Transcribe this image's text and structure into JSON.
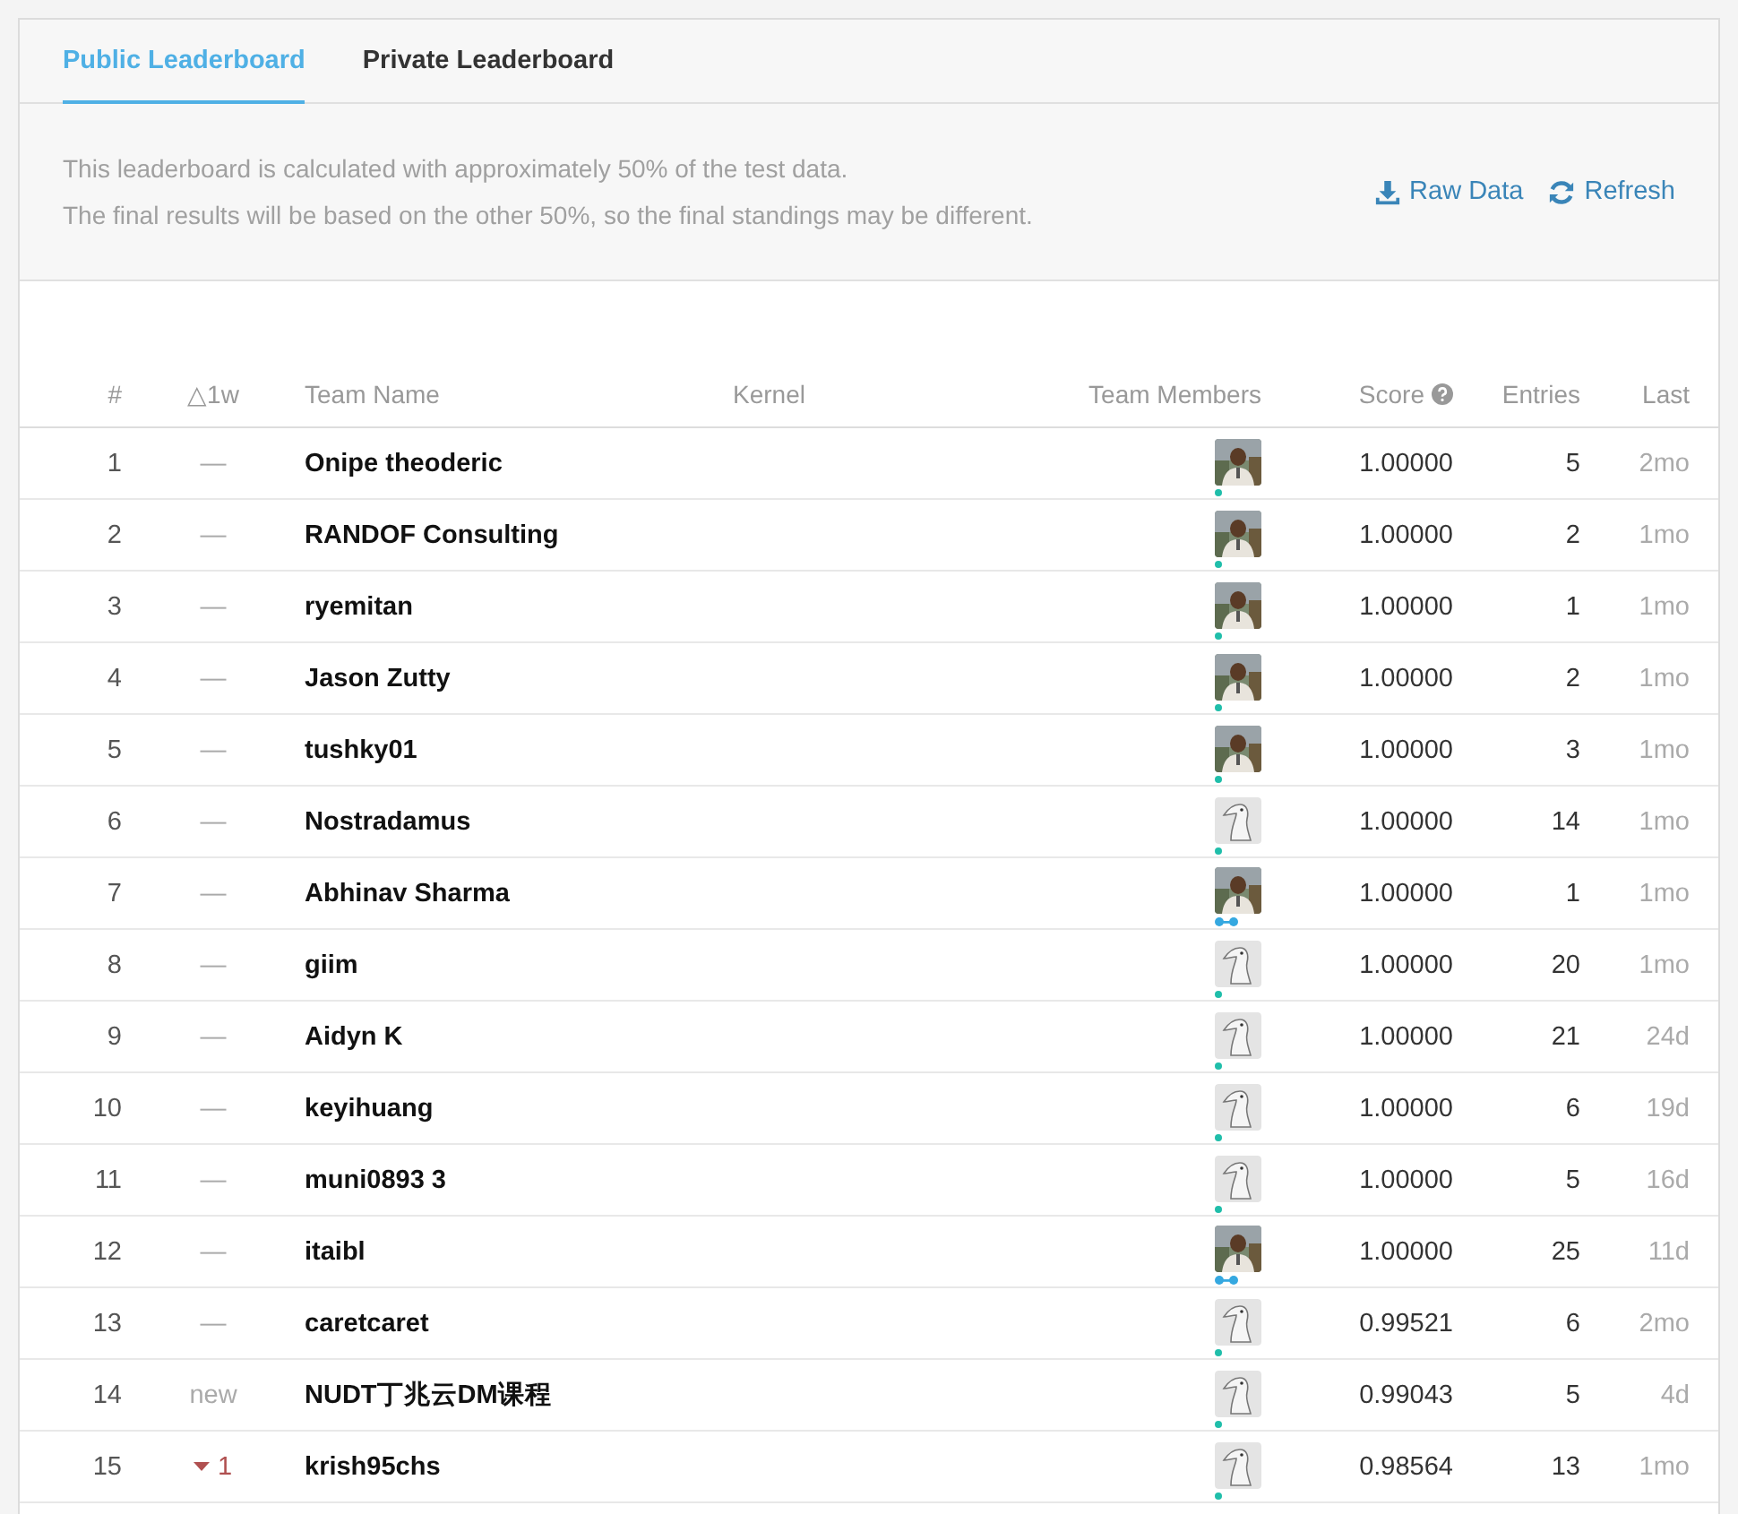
{
  "tabs": [
    {
      "label": "Public Leaderboard",
      "selected": true
    },
    {
      "label": "Private Leaderboard",
      "selected": false
    }
  ],
  "info": {
    "lines": [
      "This leaderboard is calculated with approximately 50% of the test data.",
      "The final results will be based on the other 50%, so the final standings may be different."
    ],
    "actions": [
      {
        "kind": "download",
        "label": "Raw Data"
      },
      {
        "kind": "refresh",
        "label": "Refresh"
      }
    ]
  },
  "table": {
    "columns": [
      "#",
      "△1w",
      "Team Name",
      "Kernel",
      "Team Members",
      "Score",
      "Entries",
      "Last"
    ],
    "rows": [
      {
        "rank": "1",
        "change": {
          "kind": "same",
          "text": "—"
        },
        "team": "Onipe theoderic",
        "member": {
          "badge": {
            "kind": "dot"
          }
        },
        "score": "1.00000",
        "entries": "5",
        "last": "2mo"
      },
      {
        "rank": "2",
        "change": {
          "kind": "same",
          "text": "—"
        },
        "team": "RANDOF Consulting",
        "member": {
          "badge": {
            "kind": "dot"
          }
        },
        "score": "1.00000",
        "entries": "2",
        "last": "1mo"
      },
      {
        "rank": "3",
        "change": {
          "kind": "same",
          "text": "—"
        },
        "team": "ryemitan",
        "member": {
          "badge": {
            "kind": "dot"
          }
        },
        "score": "1.00000",
        "entries": "1",
        "last": "1mo"
      },
      {
        "rank": "4",
        "change": {
          "kind": "same",
          "text": "—"
        },
        "team": "Jason Zutty",
        "member": {
          "badge": {
            "kind": "dot"
          }
        },
        "score": "1.00000",
        "entries": "2",
        "last": "1mo"
      },
      {
        "rank": "5",
        "change": {
          "kind": "same",
          "text": "—"
        },
        "team": "tushky01",
        "member": {
          "badge": {
            "kind": "dot"
          }
        },
        "score": "1.00000",
        "entries": "3",
        "last": "1mo"
      },
      {
        "rank": "6",
        "change": {
          "kind": "same",
          "text": "—"
        },
        "team": "Nostradamus",
        "member": {
          "kind": "default",
          "badge": {
            "kind": "dot"
          }
        },
        "score": "1.00000",
        "entries": "14",
        "last": "1mo"
      },
      {
        "rank": "7",
        "change": {
          "kind": "same",
          "text": "—"
        },
        "team": "Abhinav Sharma",
        "member": {
          "badge": {
            "kind": "bar"
          }
        },
        "score": "1.00000",
        "entries": "1",
        "last": "1mo"
      },
      {
        "rank": "8",
        "change": {
          "kind": "same",
          "text": "—"
        },
        "team": "giim",
        "member": {
          "kind": "default",
          "badge": {
            "kind": "dot"
          }
        },
        "score": "1.00000",
        "entries": "20",
        "last": "1mo"
      },
      {
        "rank": "9",
        "change": {
          "kind": "same",
          "text": "—"
        },
        "team": "Aidyn K",
        "member": {
          "kind": "default",
          "badge": {
            "kind": "dot"
          }
        },
        "score": "1.00000",
        "entries": "21",
        "last": "24d"
      },
      {
        "rank": "10",
        "change": {
          "kind": "same",
          "text": "—"
        },
        "team": "keyihuang",
        "member": {
          "kind": "default",
          "badge": {
            "kind": "dot"
          }
        },
        "score": "1.00000",
        "entries": "6",
        "last": "19d"
      },
      {
        "rank": "11",
        "change": {
          "kind": "same",
          "text": "—"
        },
        "team": "muni0893 3",
        "member": {
          "kind": "default",
          "badge": {
            "kind": "dot"
          }
        },
        "score": "1.00000",
        "entries": "5",
        "last": "16d"
      },
      {
        "rank": "12",
        "change": {
          "kind": "same",
          "text": "—"
        },
        "team": "itaibl",
        "member": {
          "badge": {
            "kind": "bar"
          }
        },
        "score": "1.00000",
        "entries": "25",
        "last": "11d"
      },
      {
        "rank": "13",
        "change": {
          "kind": "same",
          "text": "—"
        },
        "team": "caretcaret",
        "member": {
          "kind": "default",
          "badge": {
            "kind": "dot"
          }
        },
        "score": "0.99521",
        "entries": "6",
        "last": "2mo"
      },
      {
        "rank": "14",
        "change": {
          "kind": "new",
          "text": "new"
        },
        "team": "NUDT丁兆云DM课程",
        "member": {
          "kind": "default",
          "badge": {
            "kind": "dot"
          }
        },
        "score": "0.99043",
        "entries": "5",
        "last": "4d"
      },
      {
        "rank": "15",
        "change": {
          "kind": "down",
          "text": "1"
        },
        "team": "krish95chs",
        "member": {
          "kind": "default",
          "badge": {
            "kind": "dot"
          }
        },
        "score": "0.98564",
        "entries": "13",
        "last": "1mo"
      }
    ]
  }
}
